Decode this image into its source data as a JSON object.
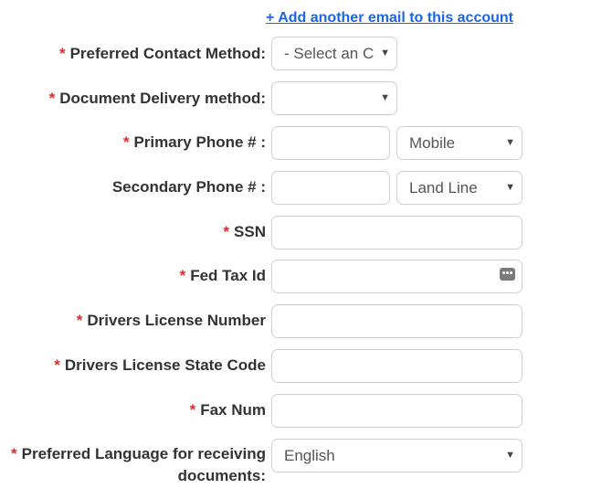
{
  "add_email_link": "+ Add another email to this account",
  "required_marker": "*",
  "rows": {
    "contact_method": {
      "label": "Preferred Contact Method:",
      "value": "- Select an C"
    },
    "document_delivery": {
      "label": "Document Delivery method:",
      "value": ""
    },
    "primary_phone": {
      "label": "Primary Phone # :",
      "value": "",
      "type": "Mobile"
    },
    "secondary_phone": {
      "label": "Secondary Phone # :",
      "value": "",
      "type": "Land Line"
    },
    "ssn": {
      "label": "SSN",
      "value": ""
    },
    "fed_tax_id": {
      "label": "Fed Tax Id",
      "value": ""
    },
    "drivers_license_number": {
      "label": "Drivers License Number",
      "value": ""
    },
    "drivers_license_state": {
      "label": "Drivers License State Code",
      "value": ""
    },
    "fax_num": {
      "label": "Fax Num",
      "value": ""
    },
    "preferred_language": {
      "label": "Preferred Language for receiving documents:",
      "value": "English"
    }
  },
  "icons": {
    "select_caret": "chevron-down-icon",
    "password_manager": "password-manager-icon"
  },
  "colors": {
    "required": "#d9302c",
    "link": "#1e66e0",
    "label": "#333333",
    "border": "#cfcfcf"
  }
}
